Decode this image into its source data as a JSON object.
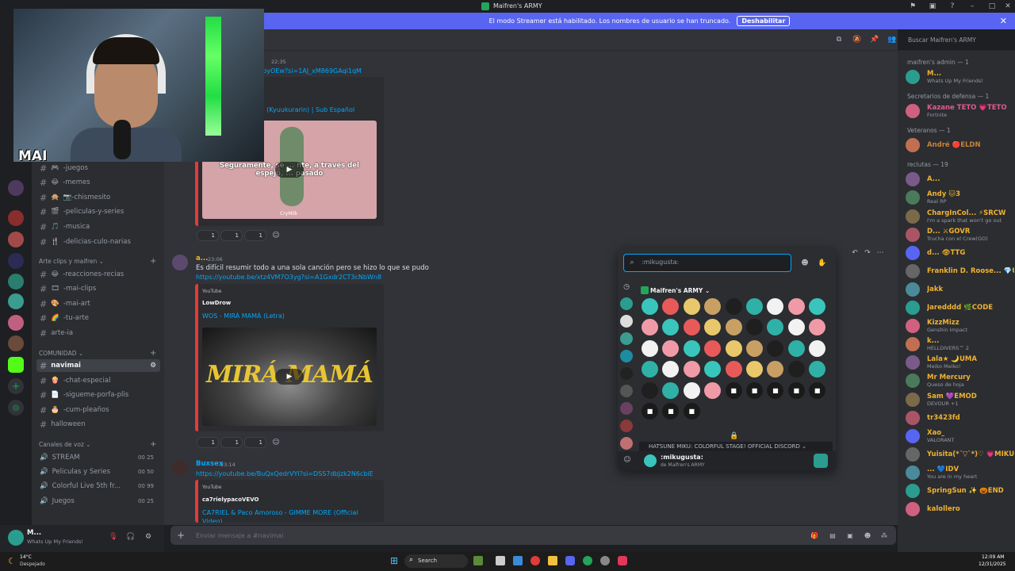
{
  "window": {
    "title": "Maifren's ARMY"
  },
  "banner": {
    "text": "El modo Streamer está habilitado. Los nombres de usuario se han truncado.",
    "button": "Deshabilitar",
    "close": "✕"
  },
  "webcam": {
    "overlay_text": "MAI"
  },
  "sidebar": {
    "channels_top": [
      {
        "label": "-juegos",
        "emoji": "🎮"
      },
      {
        "label": "-memes",
        "emoji": "😂"
      },
      {
        "label": "📷-chismesito",
        "emoji": "🙊"
      },
      {
        "label": "-peliculas-y-series",
        "emoji": "🎬"
      },
      {
        "label": "-musica",
        "emoji": "🎵"
      },
      {
        "label": "-delicias-culo-narias",
        "emoji": "🍴"
      }
    ],
    "cat_arte": "Arte clips y maifren ⌄",
    "channels_arte": [
      {
        "label": "-reacciones-recias",
        "emoji": "😂"
      },
      {
        "label": "-mai-clips",
        "emoji": "🎞"
      },
      {
        "label": "-mai-art",
        "emoji": "🎨"
      },
      {
        "label": "-tu-arte",
        "emoji": "🌈"
      },
      {
        "label": "arte-ia",
        "emoji": ""
      }
    ],
    "cat_comunidad": "COMUNIDAD ⌄",
    "channels_com": [
      {
        "label": "navimai",
        "emoji": ""
      },
      {
        "label": "-chat-especial",
        "emoji": "🍿"
      },
      {
        "label": "-sigueme-porfa-plis",
        "emoji": "📄"
      },
      {
        "label": "-cum-pleaños",
        "emoji": "🎂"
      },
      {
        "label": "halloween",
        "emoji": ""
      }
    ],
    "cat_voz": "Canales de voz ⌄",
    "voice": [
      {
        "label": "STREAM",
        "count": "00 25"
      },
      {
        "label": "Peliculas y Series",
        "count": "00 50"
      },
      {
        "label": "Colorful Live 5th fr...",
        "count": "00 99"
      },
      {
        "label": "Juegos",
        "count": "00 25"
      }
    ]
  },
  "user": {
    "name": "M...",
    "status": "Whats Up My Friends!"
  },
  "search": {
    "placeholder": "Buscar Maifren's ARMY"
  },
  "messages": {
    "m1": {
      "time": "22:35",
      "link": "...oYoyOEw?si=1AJ_xM869GAqi1qM",
      "embed_title": "...ん (Kyuukurarin) | Sub Español",
      "caption1": "Seguramente, se ... nte, a través del",
      "caption2": "espejo, ... pasado",
      "watermark": "CryMilk",
      "reacts": [
        "1",
        "1",
        "1"
      ]
    },
    "m2": {
      "author": "a...",
      "time": "23:06",
      "text": "Es difícil resumir todo a una sola canción pero se hizo lo que se pudo",
      "link": "https://youtube.be/xtz4VM7O3yg?si=A1Gxdr2CT3cNbWn8",
      "provider": "YouTube",
      "channel": "LowDrow",
      "embed_title": "WOS - MIRÁ MAMÁ (Letra)",
      "thumb_text": "MIRÁ MAMÁ",
      "reacts": [
        "1",
        "1",
        "1"
      ]
    },
    "m3": {
      "author": "Buxsex",
      "time": "23:14",
      "link": "https://youtube.be/BuQxQedrVYI?si=DSS7dbJzk2N6cbiE",
      "provider": "YouTube",
      "channel": "ca7rielypacoVEVO",
      "embed_title": "CA7RIEL & Paco Amoroso - GIMME MORE (Official",
      "embed_title2": "Video)"
    }
  },
  "composer": {
    "placeholder": "Enviar mensaje a #navimai"
  },
  "picker": {
    "query": ":mikugusta:",
    "server": "Maifren's ARMY ⌄",
    "footer_server": "HATSUNE MIKU: COLORFUL STAGE! OFFICIAL DISCORD ⌄",
    "selected_name": ":mikugusta:",
    "selected_from": "de Maifren's ARMY"
  },
  "members": {
    "groups": [
      {
        "header": "maifren's admin — 1",
        "members": [
          {
            "name": "M...",
            "status": "Whats Up My Friends!",
            "color": "#f0b232"
          }
        ]
      },
      {
        "header": "Secretarios de defensa — 1",
        "members": [
          {
            "name": "Kazane TETO 💗TETO",
            "status": "Fortnite",
            "color": "#e05b8d"
          }
        ]
      },
      {
        "header": "Veteranos — 1",
        "members": [
          {
            "name": "André 🔴ELDN",
            "status": "",
            "color": "#c7823a"
          }
        ]
      },
      {
        "header": "reclutas — 19",
        "members": [
          {
            "name": "A...",
            "status": "",
            "color": "#f0b232"
          },
          {
            "name": "Andy 🐱3",
            "status": "Real RP",
            "color": "#f0b232"
          },
          {
            "name": "ChargInCol... ⚡SRCW",
            "status": "I'm a spark that won't go out",
            "color": "#f0b232"
          },
          {
            "name": "D... ⚔GOVR",
            "status": "Trucha con el Crew(GO)",
            "color": "#f0b232"
          },
          {
            "name": "d... 👁TTG",
            "status": "",
            "color": "#f0b232"
          },
          {
            "name": "Franklin D. Roose... 💎URU",
            "status": "",
            "color": "#f0b232"
          },
          {
            "name": "Jakk",
            "status": "",
            "color": "#f0b232"
          },
          {
            "name": "Jaredddd 🌿CODE",
            "status": "",
            "color": "#f0b232"
          },
          {
            "name": "KizzMizz",
            "status": "Genshin Impact",
            "color": "#f0b232"
          },
          {
            "name": "k...",
            "status": "HELLDIVERS™ 2",
            "color": "#f0b232"
          },
          {
            "name": "Lala★ 🌙UMA",
            "status": "Meiko Meiko!",
            "color": "#f0b232"
          },
          {
            "name": "Mr Mercury",
            "status": "Queso de hoja",
            "color": "#f0b232"
          },
          {
            "name": "Sam 💜EMOD",
            "status": "DEVOUR +1",
            "color": "#f0b232"
          },
          {
            "name": "tr3423fd",
            "status": "",
            "color": "#f0b232"
          },
          {
            "name": "Xao_",
            "status": "VALORANT",
            "color": "#f0b232"
          },
          {
            "name": "Yuisita(*´▽`*)♡ 💗MIKU",
            "status": "",
            "color": "#f0b232"
          },
          {
            "name": "... 💙IDV",
            "status": "You are in my heart",
            "color": "#f0b232"
          },
          {
            "name": "SpringSun ✨ 🎃END",
            "status": "",
            "color": "#f0b232"
          },
          {
            "name": "kalollero",
            "status": "",
            "color": "#f0b232"
          }
        ]
      }
    ]
  },
  "taskbar": {
    "search": "Search",
    "weather_temp": "14°C",
    "weather_desc": "Despejado",
    "time": "12:09 AM",
    "date": "12/31/2025"
  },
  "colors": {
    "accent": "#5865f2",
    "link": "#00a8fc",
    "embed_bar": "#e23b3b",
    "name_yellow": "#f0b232"
  }
}
